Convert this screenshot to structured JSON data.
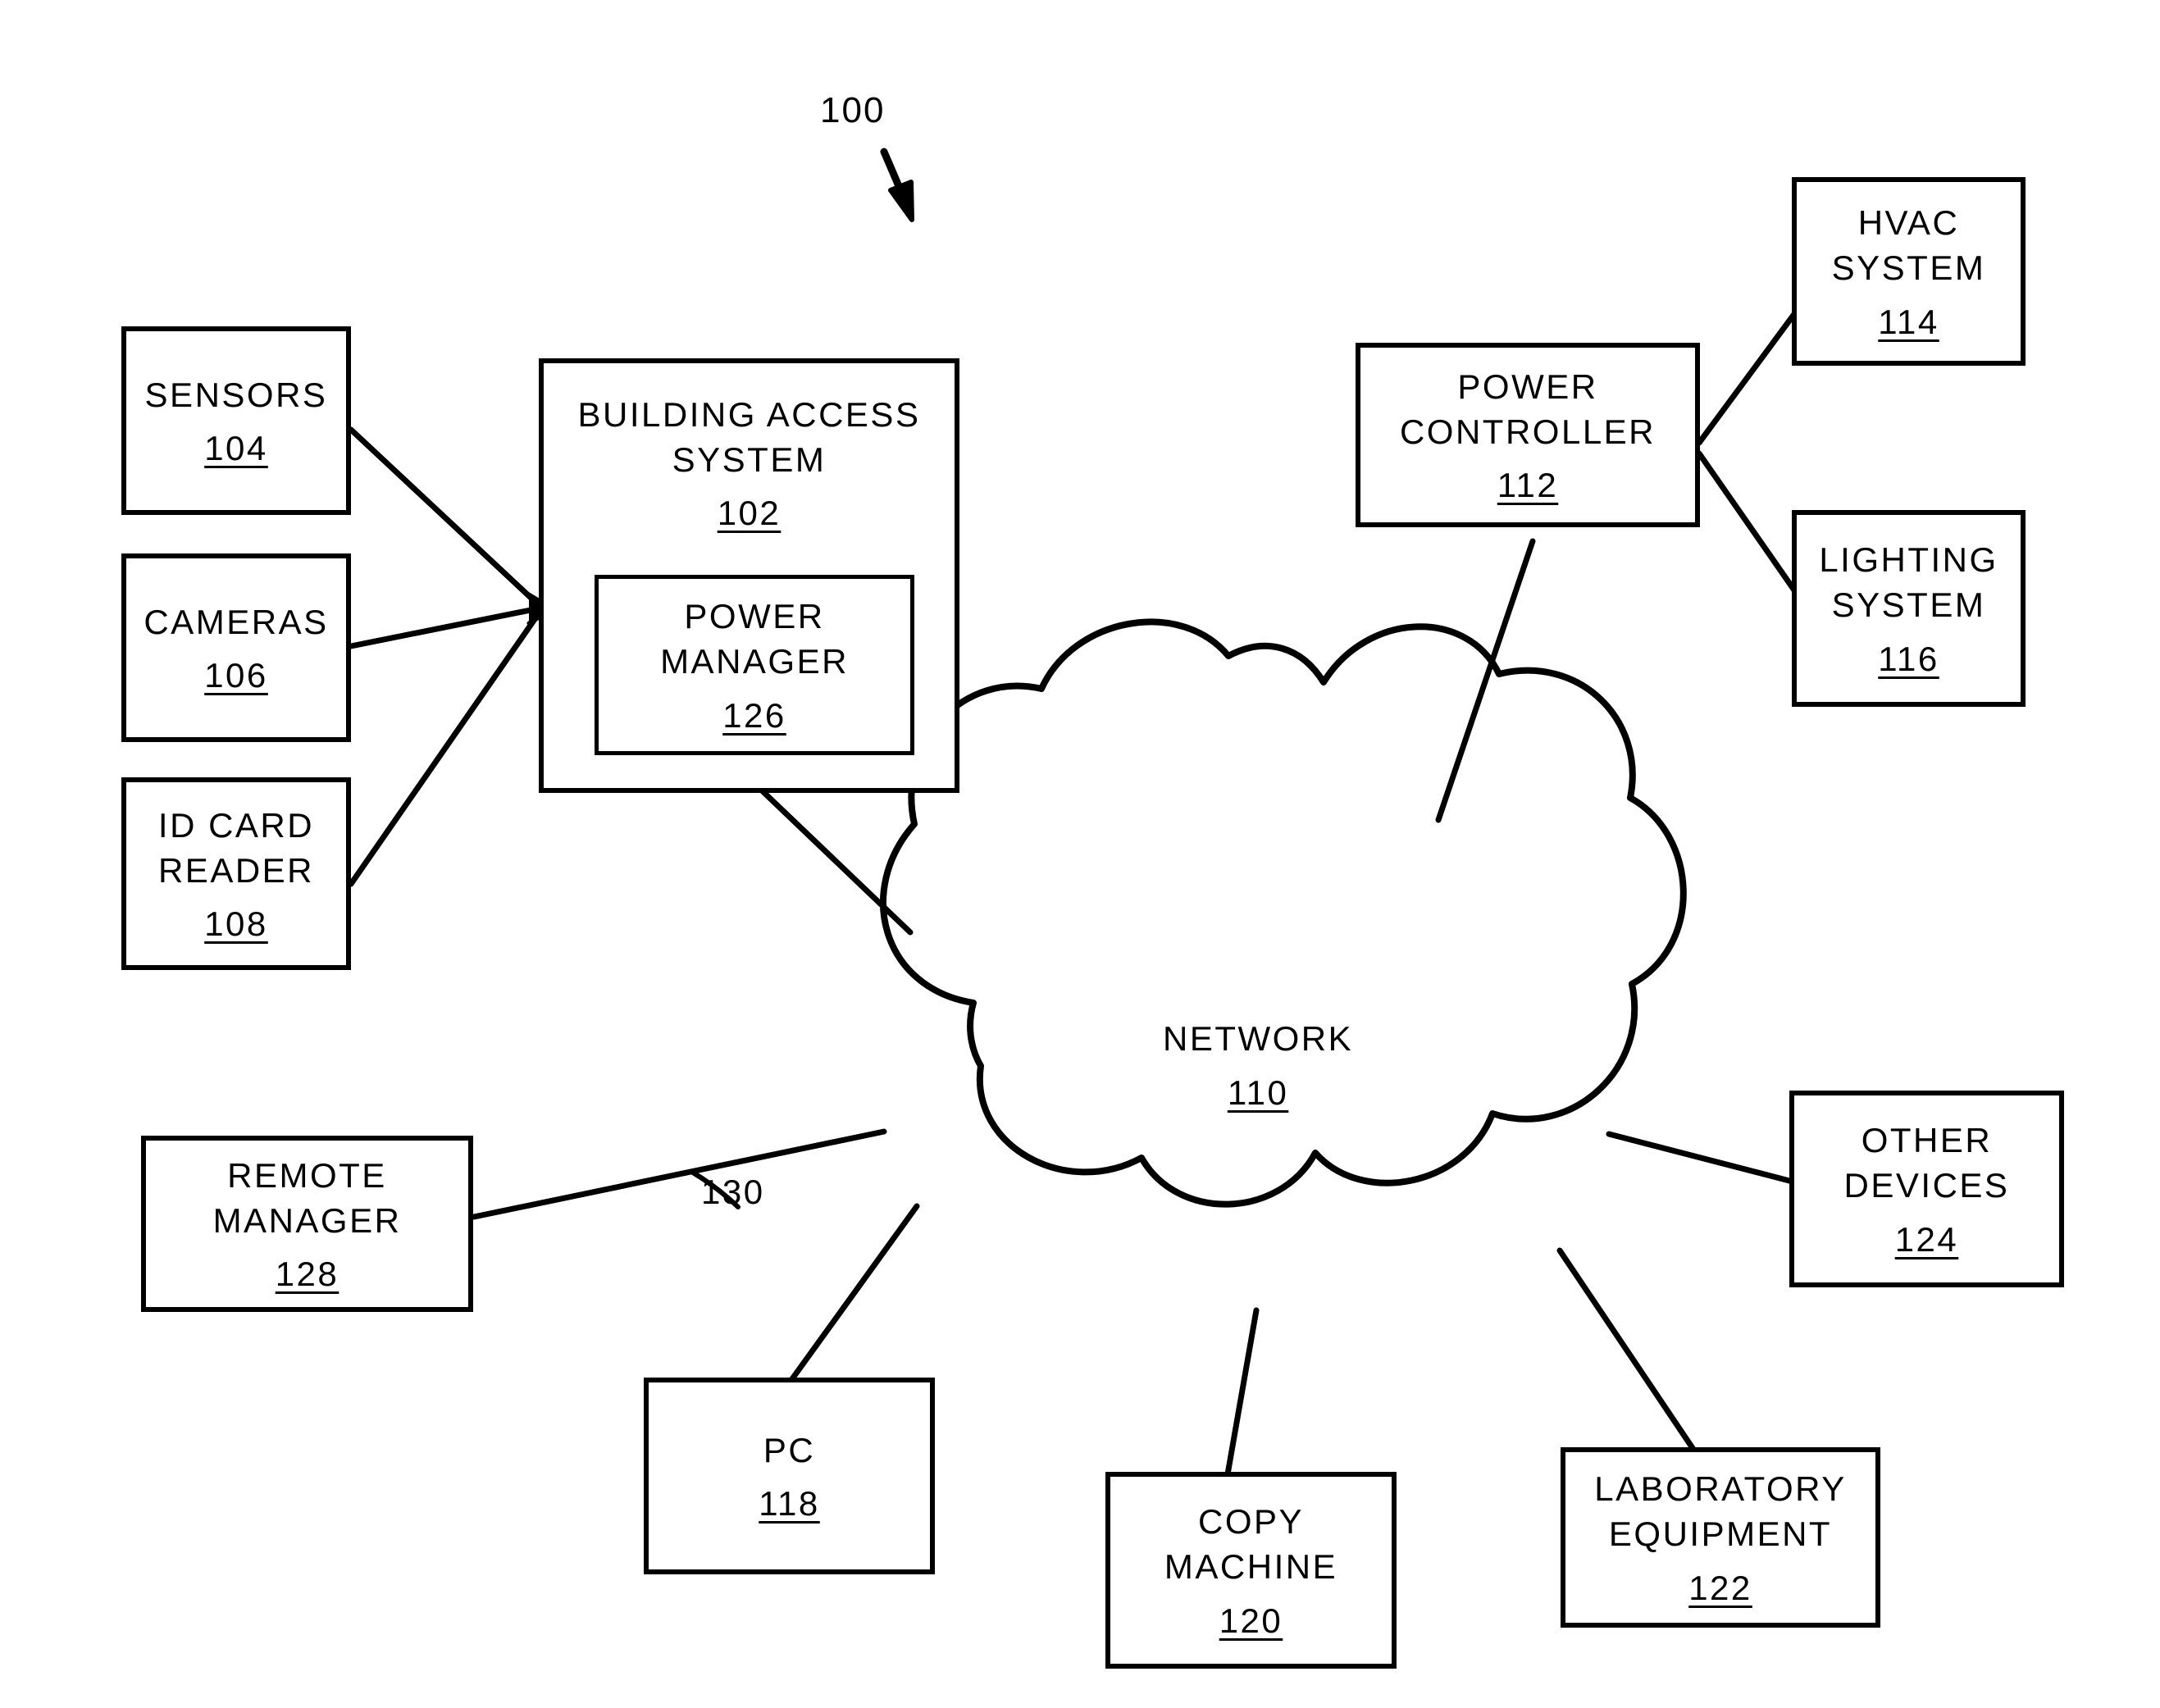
{
  "figure": {
    "number": "100",
    "arrow_icon": "down-right-arrow-icon"
  },
  "callouts": [
    {
      "id": "c130",
      "label": "130"
    }
  ],
  "nodes": [
    {
      "id": "sensors",
      "title": "SENSORS",
      "ref": "104"
    },
    {
      "id": "cameras",
      "title": "CAMERAS",
      "ref": "106"
    },
    {
      "id": "id_card_reader",
      "title": "ID CARD\nREADER",
      "ref": "108"
    },
    {
      "id": "building_access",
      "title": "BUILDING ACCESS\nSYSTEM",
      "ref": "102"
    },
    {
      "id": "power_manager",
      "title": "POWER\nMANAGER",
      "ref": "126"
    },
    {
      "id": "power_controller",
      "title": "POWER\nCONTROLLER",
      "ref": "112"
    },
    {
      "id": "hvac",
      "title": "HVAC\nSYSTEM",
      "ref": "114"
    },
    {
      "id": "lighting",
      "title": "LIGHTING\nSYSTEM",
      "ref": "116"
    },
    {
      "id": "network",
      "title": "NETWORK",
      "ref": "110"
    },
    {
      "id": "other_devices",
      "title": "OTHER\nDEVICES",
      "ref": "124"
    },
    {
      "id": "remote_manager",
      "title": "REMOTE\nMANAGER",
      "ref": "128"
    },
    {
      "id": "pc",
      "title": "PC",
      "ref": "118"
    },
    {
      "id": "copy_machine",
      "title": "COPY\nMACHINE",
      "ref": "120"
    },
    {
      "id": "lab_equipment",
      "title": "LABORATORY\nEQUIPMENT",
      "ref": "122"
    }
  ],
  "connections": [
    {
      "from": "sensors",
      "to": "building_access"
    },
    {
      "from": "cameras",
      "to": "building_access"
    },
    {
      "from": "id_card_reader",
      "to": "building_access"
    },
    {
      "from": "building_access",
      "to": "network"
    },
    {
      "from": "remote_manager",
      "to": "network"
    },
    {
      "from": "pc",
      "to": "network"
    },
    {
      "from": "copy_machine",
      "to": "network"
    },
    {
      "from": "lab_equipment",
      "to": "network"
    },
    {
      "from": "other_devices",
      "to": "network"
    },
    {
      "from": "power_controller",
      "to": "network"
    },
    {
      "from": "power_controller",
      "to": "hvac"
    },
    {
      "from": "power_controller",
      "to": "lighting"
    }
  ],
  "colors": {
    "stroke": "#000000",
    "background": "#ffffff"
  }
}
